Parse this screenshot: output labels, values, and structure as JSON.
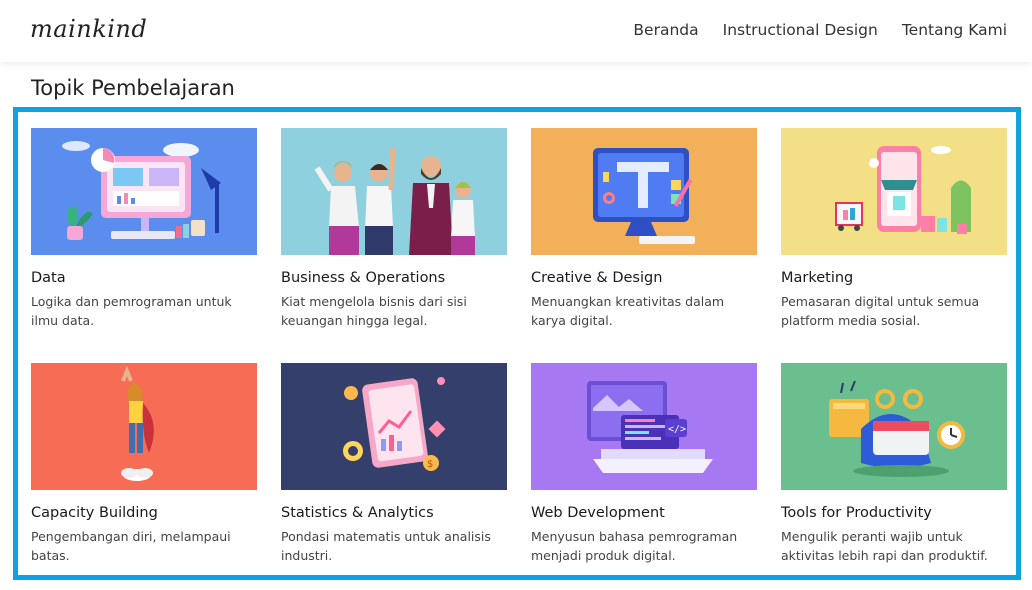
{
  "brand": "mainkind",
  "nav": [
    {
      "label": "Beranda"
    },
    {
      "label": "Instructional Design"
    },
    {
      "label": "Tentang Kami"
    }
  ],
  "heading": "Topik Pembelajaran",
  "cards": [
    {
      "title": "Data",
      "desc": "Logika dan pemrograman untuk ilmu data.",
      "bg": "#5b8def",
      "icon": "data-dashboard-illustration"
    },
    {
      "title": "Business & Operations",
      "desc": "Kiat mengelola bisnis dari sisi keuangan hingga legal.",
      "bg": "#8fd0de",
      "icon": "business-people-illustration"
    },
    {
      "title": "Creative & Design",
      "desc": "Menuangkan kreativitas dalam karya digital.",
      "bg": "#f2b05a",
      "icon": "design-monitor-illustration"
    },
    {
      "title": "Marketing",
      "desc": "Pemasaran digital untuk semua platform media sosial.",
      "bg": "#f3df86",
      "icon": "online-shop-illustration"
    },
    {
      "title": "Capacity Building",
      "desc": "Pengembangan diri, melampaui batas.",
      "bg": "#f76c55",
      "icon": "flying-hero-illustration"
    },
    {
      "title": "Statistics & Analytics",
      "desc": "Pondasi matematis untuk analisis industri.",
      "bg": "#343f6b",
      "icon": "analytics-report-illustration"
    },
    {
      "title": "Web Development",
      "desc": "Menyusun bahasa pemrograman menjadi produk digital.",
      "bg": "#a678f2",
      "icon": "laptop-code-illustration"
    },
    {
      "title": "Tools for Productivity",
      "desc": "Mengulik peranti wajib untuk aktivitas lebih rapi dan produktif.",
      "bg": "#6bbf8e",
      "icon": "calendar-tools-illustration"
    }
  ]
}
